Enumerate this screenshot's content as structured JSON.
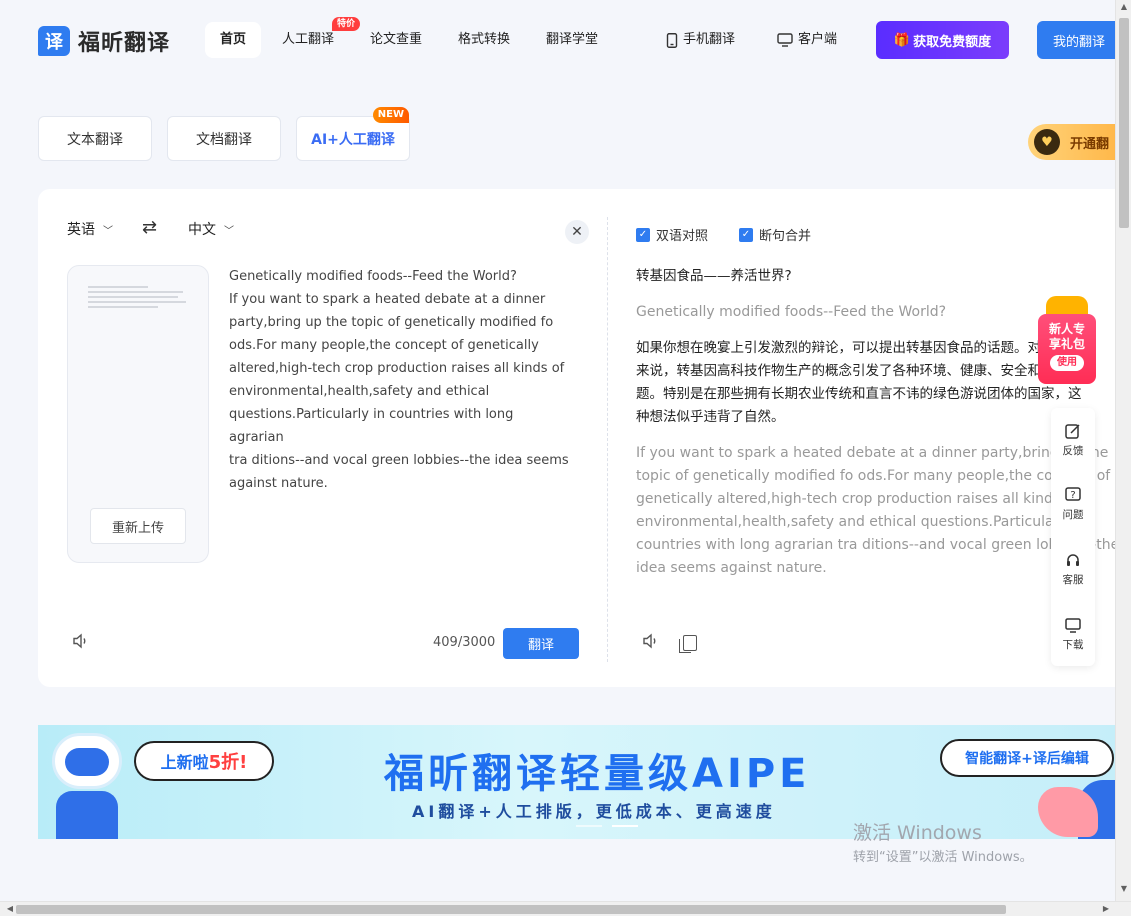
{
  "brand": {
    "logo_char": "译",
    "name": "福昕翻译"
  },
  "nav": {
    "items": [
      {
        "label": "首页"
      },
      {
        "label": "人工翻译",
        "badge": "特价"
      },
      {
        "label": "论文查重"
      },
      {
        "label": "格式转换"
      },
      {
        "label": "翻译学堂"
      }
    ],
    "mobile_label": "手机翻译",
    "desktop_label": "客户端",
    "free_button": "获取免费额度",
    "mine_button": "我的翻译"
  },
  "modes": {
    "text": "文本翻译",
    "doc": "文档翻译",
    "ai": "AI+人工翻译",
    "ai_badge": "NEW",
    "vip": "开通翻"
  },
  "source": {
    "lang": "英语",
    "lines": [
      "Genetically modified foods--Feed the World?",
      "If you want to spark a heated debate at a dinner",
      "party,bring up the topic of genetically modified fo",
      "ods.For many people,the concept of genetically",
      "altered,high-tech crop production raises all kinds of",
      "environmental,health,safety and ethical",
      "questions.Particularly in countries with long agrarian",
      "tra ditions--and vocal green lobbies--the idea seems",
      "against nature."
    ],
    "reupload": "重新上传",
    "counter": "409/3000",
    "translate_button": "翻译"
  },
  "target": {
    "lang": "中文",
    "option_bilingual": "双语对照",
    "option_merge": "断句合并",
    "title_zh": "转基因食品——养活世界?",
    "title_en": "Genetically modified foods--Feed the World?",
    "para_zh": [
      "如果你想在晚宴上引发激烈的辩论，可以提出转基因食品的话题。对许多人",
      "来说，转基因高科技作物生产的概念引发了各种环境、健康、安全和伦理问",
      "题。特别是在那些拥有长期农业传统和直言不讳的绿色游说团体的国家，这",
      "种想法似乎违背了自然。"
    ],
    "para_en": [
      "If you want to spark a heated debate at a dinner party,bring up the",
      "topic of genetically modified fo ods.For many people,the concept of",
      "genetically altered,high-tech crop production raises all kinds of",
      "environmental,health,safety and ethical questions.Particularly in",
      "countries with long agrarian tra ditions--and vocal green lobbies--the",
      "idea seems against nature."
    ]
  },
  "gift": {
    "line1": "新人专",
    "line2": "享礼包",
    "use": "使用"
  },
  "sidebar_tools": [
    {
      "label": "反馈",
      "icon": "feedback-icon"
    },
    {
      "label": "问题",
      "icon": "question-icon"
    },
    {
      "label": "客服",
      "icon": "headset-icon"
    },
    {
      "label": "下载",
      "icon": "monitor-icon"
    }
  ],
  "banner": {
    "bubble_prefix": "上新啦",
    "bubble_highlight": "5折!",
    "title": "福昕翻译轻量级AIPE",
    "subtitle": "AI翻译+人工排版，更低成本、更高速度",
    "right_bubble": "智能翻译+译后编辑"
  },
  "watermark": {
    "line1": "激活 Windows",
    "line2": "转到“设置”以激活 Windows。"
  },
  "colors": {
    "primary": "#2f7cf0",
    "purple": "#5a2dff",
    "badge_red": "#ff3d3d"
  }
}
